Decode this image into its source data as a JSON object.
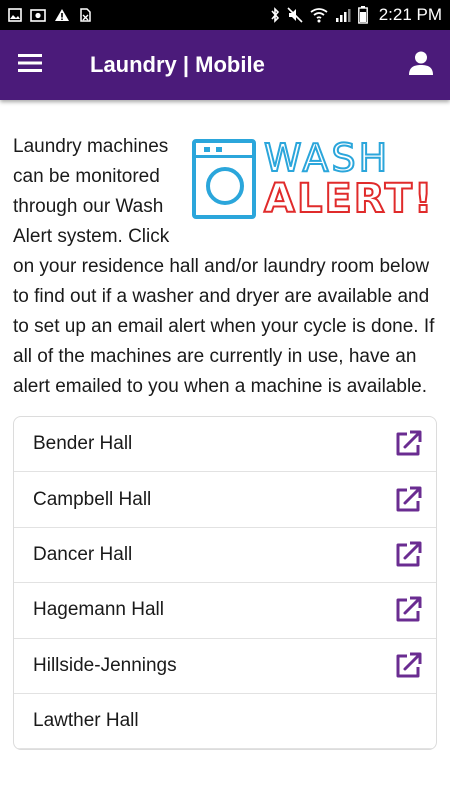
{
  "status_bar": {
    "time": "2:21 PM",
    "left_icons": [
      "gallery-icon",
      "photo-icon",
      "warning-icon",
      "no-sim-icon"
    ],
    "right_icons": [
      "bluetooth-icon",
      "mute-icon",
      "wifi-icon",
      "signal-icon",
      "battery-icon"
    ]
  },
  "app_bar": {
    "title": "Laundry | Mobile",
    "menu_icon": "hamburger-menu-icon",
    "user_icon": "user-icon",
    "color": "#4b1b7a"
  },
  "intro": {
    "text": "Laundry machines can be monitored through our Wash Alert system. Click on your residence hall and/or laundry room below to find out if a washer and dryer are available and to set up an email alert when your cycle is done. If all of the machines are currently in use, have an alert emailed to you when a machine is available."
  },
  "logo": {
    "word1": "WASH",
    "word2": "ALERT!",
    "blue": "#2ba6db",
    "red": "#e02b2b"
  },
  "halls": [
    {
      "name": "Bender Hall",
      "external": true
    },
    {
      "name": "Campbell Hall",
      "external": true
    },
    {
      "name": "Dancer Hall",
      "external": true
    },
    {
      "name": "Hagemann Hall",
      "external": true
    },
    {
      "name": "Hillside-Jennings",
      "external": true
    },
    {
      "name": "Lawther Hall",
      "external": false
    }
  ],
  "accent_color": "#6a2c91"
}
